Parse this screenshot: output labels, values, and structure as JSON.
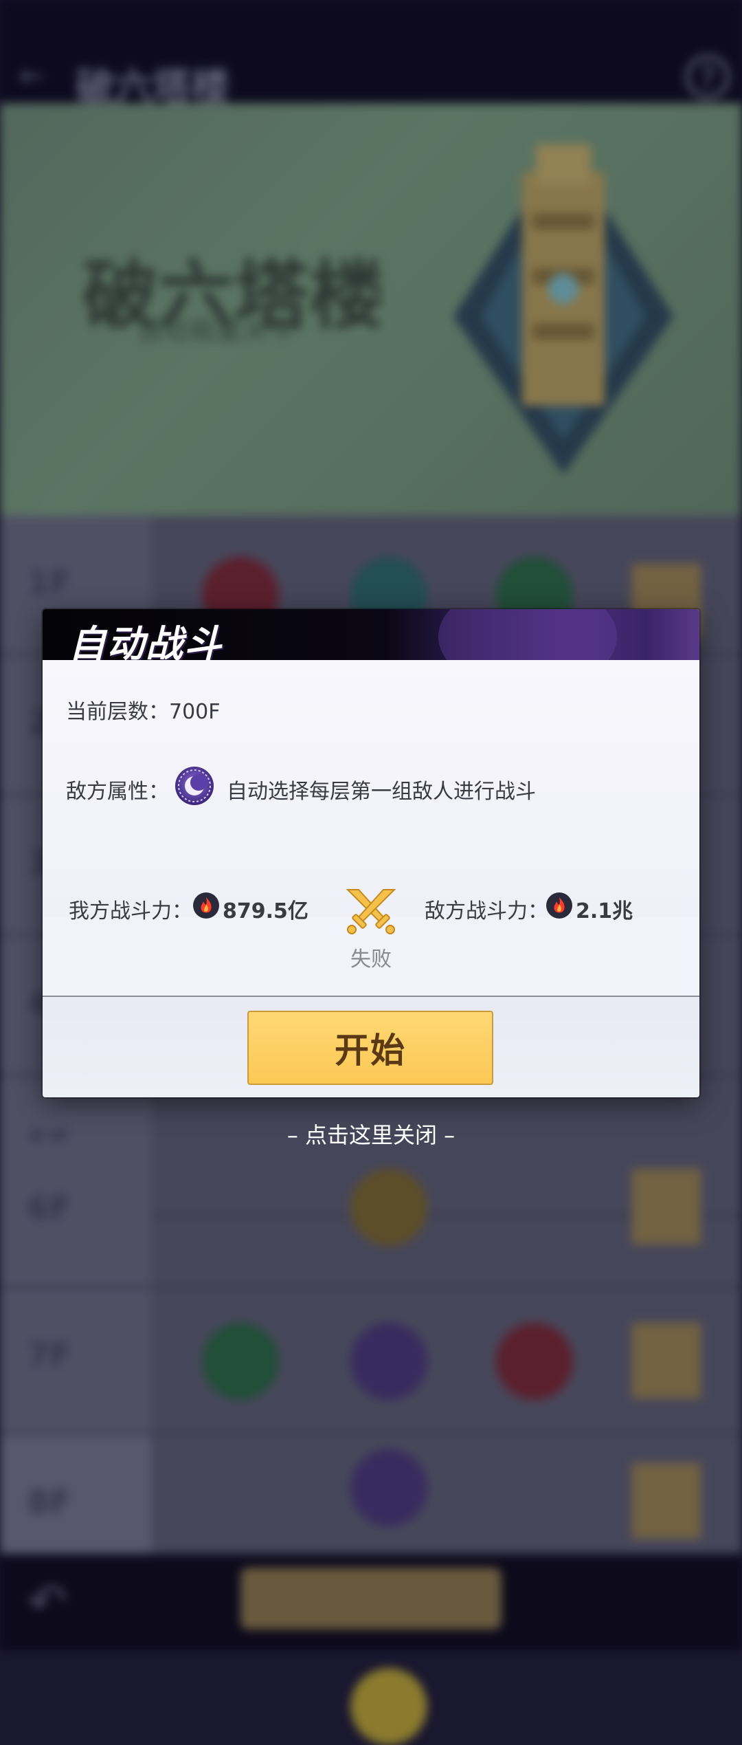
{
  "background": {
    "page_title": "破六塔楼",
    "banner_title": "破六塔楼",
    "banner_subtitle": "自动裁量关卡",
    "back_icon": "arrow-left-icon",
    "help_icon": "question-mark-icon",
    "row_labels": [
      "1F",
      "2F",
      "3F",
      "4F",
      "5F",
      "6F",
      "7F",
      "8F"
    ]
  },
  "dialog": {
    "title": "自动战斗",
    "current_floor_label": "当前层数：",
    "current_floor_value": "700F",
    "enemy_attr_label": "敌方属性：",
    "enemy_attr_icon": "moon-element-icon",
    "enemy_attr_text": "自动选择每层第一组敌人进行战斗",
    "our_power_label": "我方战斗力：",
    "our_power_value": "879.5亿",
    "enemy_power_label": "敌方战斗力：",
    "enemy_power_value": "2.1兆",
    "power_icon": "fire-icon",
    "versus_icon": "crossed-swords-icon",
    "result": "失败",
    "start_button": "开始"
  },
  "close_hint": "– 点击这里关闭 –",
  "colors": {
    "header_dark": "#040306",
    "header_purple": "#4a2d7a",
    "button_gold": "#fbc855",
    "button_text": "#5a3914",
    "body_bg": "#f2f2fa"
  }
}
